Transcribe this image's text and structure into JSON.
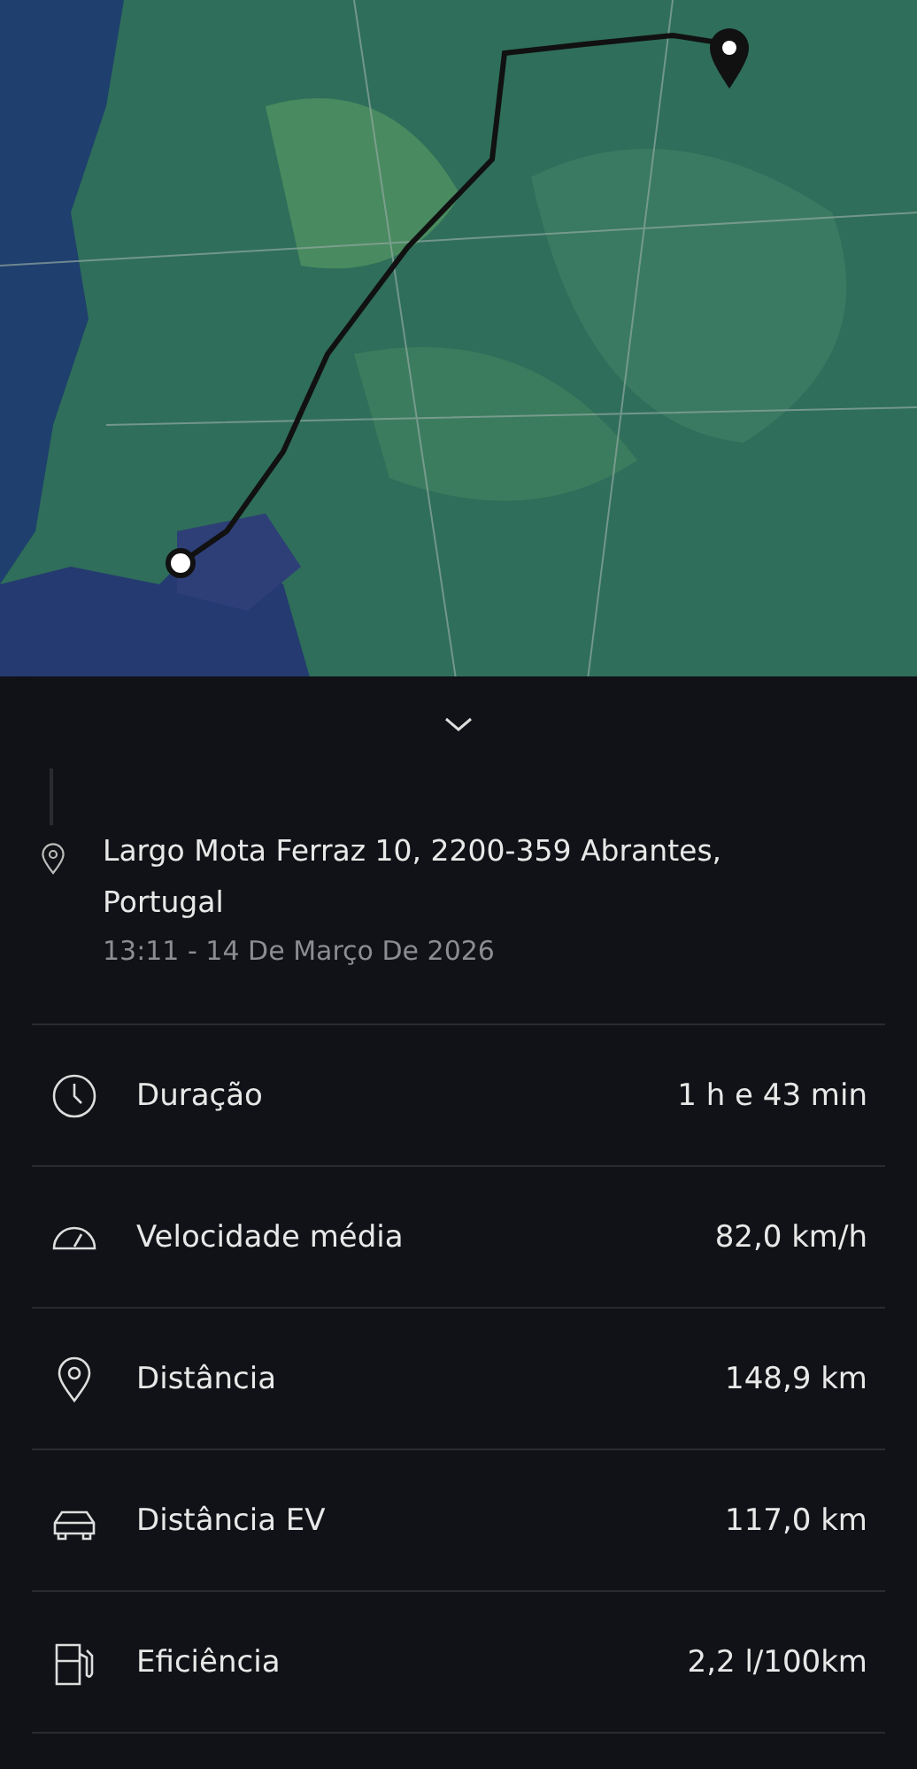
{
  "sheet": {
    "address": {
      "lines": [
        "Largo Mota Ferraz 10, 2200-359 Abrantes, Portugal"
      ],
      "datetime": "13:11 - 14 De Março De 2026"
    },
    "stats": [
      {
        "kind": "duration",
        "label": "Duração",
        "value": "1 h e 43 min"
      },
      {
        "kind": "speed",
        "label": "Velocidade média",
        "value": "82,0 km/h"
      },
      {
        "kind": "distance",
        "label": "Distância",
        "value": "148,9 km"
      },
      {
        "kind": "ev",
        "label": "Distância EV",
        "value": "117,0 km"
      },
      {
        "kind": "fuel",
        "label": "Eficiência",
        "value": "2,2 l/100km"
      }
    ]
  }
}
